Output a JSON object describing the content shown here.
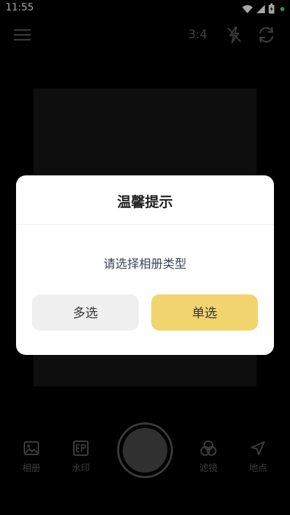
{
  "status_bar": {
    "time": "11:55",
    "icons": [
      "wifi-icon",
      "signal-icon",
      "battery-icon"
    ]
  },
  "top_bar": {
    "menu_icon": "menu-icon",
    "ratio": "3:4",
    "flash_icon": "flash-off-icon",
    "switch_icon": "camera-switch-icon"
  },
  "dialog": {
    "title": "温馨提示",
    "message": "请选择相册类型",
    "multi_label": "多选",
    "single_label": "单选"
  },
  "bottom_bar": {
    "items": [
      {
        "label": "相册",
        "icon": "album-icon"
      },
      {
        "label": "水印",
        "icon": "watermark-icon"
      },
      {
        "label": "滤镜",
        "icon": "filter-icon"
      },
      {
        "label": "地点",
        "icon": "location-icon"
      }
    ],
    "shutter_icon": "shutter-button"
  },
  "colors": {
    "background": "#000000",
    "accent": "#f2d46e",
    "secondary_button": "#efefef",
    "muted": "#5e5e5e"
  }
}
